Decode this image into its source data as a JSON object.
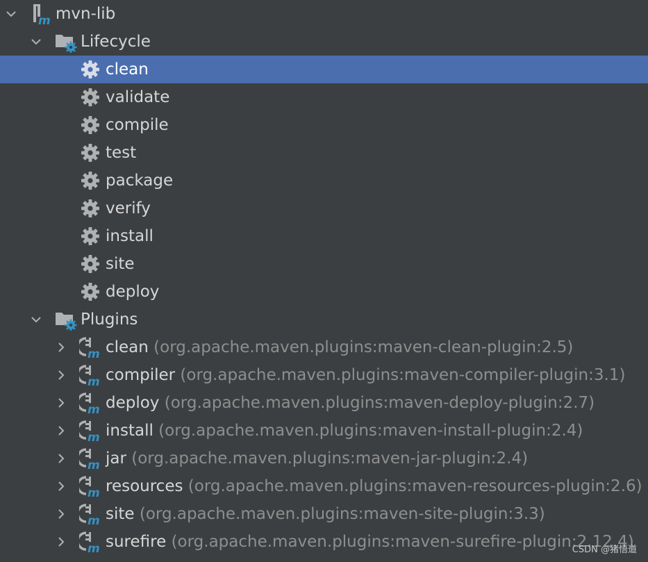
{
  "project": {
    "name": "mvn-lib",
    "icon": "maven-module-icon",
    "expanded": true
  },
  "lifecycle": {
    "label": "Lifecycle",
    "icon": "folder-gear-icon",
    "expanded": true,
    "goals": [
      {
        "label": "clean",
        "selected": true
      },
      {
        "label": "validate",
        "selected": false
      },
      {
        "label": "compile",
        "selected": false
      },
      {
        "label": "test",
        "selected": false
      },
      {
        "label": "package",
        "selected": false
      },
      {
        "label": "verify",
        "selected": false
      },
      {
        "label": "install",
        "selected": false
      },
      {
        "label": "site",
        "selected": false
      },
      {
        "label": "deploy",
        "selected": false
      }
    ]
  },
  "plugins": {
    "label": "Plugins",
    "icon": "folder-gear-icon",
    "expanded": true,
    "items": [
      {
        "name": "clean",
        "detail": "(org.apache.maven.plugins:maven-clean-plugin:2.5)"
      },
      {
        "name": "compiler",
        "detail": "(org.apache.maven.plugins:maven-compiler-plugin:3.1)"
      },
      {
        "name": "deploy",
        "detail": "(org.apache.maven.plugins:maven-deploy-plugin:2.7)"
      },
      {
        "name": "install",
        "detail": "(org.apache.maven.plugins:maven-install-plugin:2.4)"
      },
      {
        "name": "jar",
        "detail": "(org.apache.maven.plugins:maven-jar-plugin:2.4)"
      },
      {
        "name": "resources",
        "detail": "(org.apache.maven.plugins:maven-resources-plugin:2.6)"
      },
      {
        "name": "site",
        "detail": "(org.apache.maven.plugins:maven-site-plugin:3.3)"
      },
      {
        "name": "surefire",
        "detail": "(org.apache.maven.plugins:maven-surefire-plugin:2.12.4)"
      }
    ]
  },
  "watermark": "CSDN @猪悟道",
  "colors": {
    "background": "#3c3f41",
    "selection": "#4b6eaf",
    "text": "#d6d6d6",
    "detail_text": "#8e8e8e",
    "maven_blue": "#3592c4",
    "icon_gray": "#afb1b3"
  }
}
